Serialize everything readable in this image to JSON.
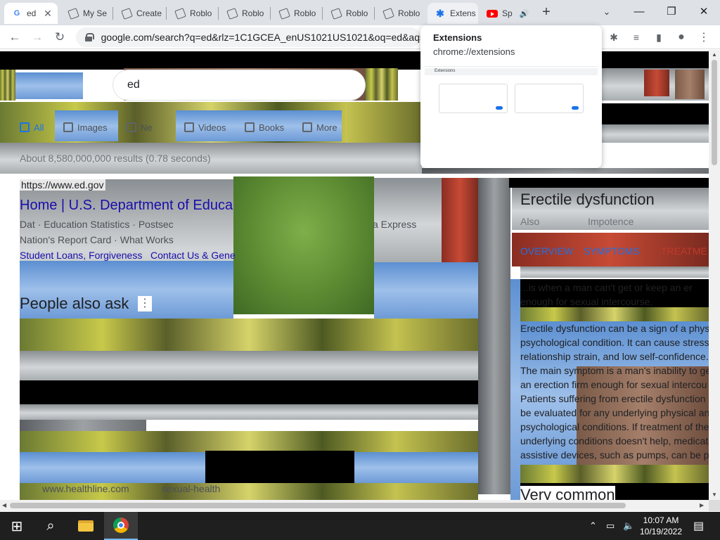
{
  "tabs": [
    {
      "title": "ed",
      "favicon": "google-icon",
      "active": true,
      "closable": true
    },
    {
      "title": "My Se",
      "favicon": "document-icon"
    },
    {
      "title": "Create",
      "favicon": "document-icon"
    },
    {
      "title": "Roblo",
      "favicon": "document-icon"
    },
    {
      "title": "Roblo",
      "favicon": "document-icon"
    },
    {
      "title": "Roblo",
      "favicon": "document-icon"
    },
    {
      "title": "Roblo",
      "favicon": "document-icon"
    },
    {
      "title": "Roblo",
      "favicon": "document-icon"
    },
    {
      "title": "Extens",
      "favicon": "puzzle-icon",
      "hovered": true
    },
    {
      "title": "Sp",
      "favicon": "youtube-icon",
      "audio": true
    }
  ],
  "glyphs": {
    "close": "✕",
    "new_tab": "+",
    "tab_search": "⌄",
    "minimize": "—",
    "restore": "❐",
    "window_close": "✕",
    "back": "←",
    "forward": "→",
    "reload": "↻",
    "puzzle": "✱",
    "queue": "≡",
    "sidepanel": "▮",
    "profile": "●",
    "menu": "⋮",
    "audio": "🔊",
    "up": "▲",
    "down": "▼",
    "left": "◀",
    "right": "▶",
    "kebab": "⋮",
    "windows": "⊞",
    "search": "⌕",
    "chevron_up": "⌃",
    "network": "▭",
    "volume": "🔈",
    "notification": "▤"
  },
  "address_bar": {
    "url": "google.com/search?q=ed&rlz=1C1GCEA_enUS1021US1021&oq=ed&aqs="
  },
  "search": {
    "query": "ed",
    "chips": [
      "All",
      "Images",
      "Ne",
      "Videos",
      "Books",
      "More"
    ],
    "result_stats": "About 8,580,000,000 results (0.78 seconds)",
    "result1": {
      "url": "https://www.ed.gov",
      "title": "Home | U.S. Department of Educa",
      "sitelinks_row1": "Dat    ·    Education Statistics · Postsec",
      "sitelinks_tail": "a Express",
      "sitelinks_row2": "Nation's Report Card · What Works",
      "sitelink_student": "Student Loans, Forgiveness",
      "sitelink_contact": "Contact Us & Gene"
    },
    "people_also_ask": "People also ask",
    "healthline_url": "www.healthline.com",
    "healthline_tail": "sexual-health"
  },
  "knowledge_panel": {
    "title": "Erectile dysfunction",
    "subtitle_left": "Also",
    "subtitle_right": "Impotence",
    "tabs": [
      "OVERVIEW",
      "SYMPTOMS",
      "TREATME"
    ],
    "intro": "...is when a man can't get or keep an er",
    "intro2": "enough for sexual intercourse.",
    "body": [
      "Erectile dysfunction can be a sign of a phys",
      "psychological condition. It can cause stress",
      "relationship strain, and low self-confidence.",
      "The main symptom is a man's inability to ge",
      "an erection firm enough for sexual intercou",
      "Patients suffering from erectile dysfunction",
      "be evaluated for any underlying physical an",
      "psychological conditions. If treatment of the",
      "underlying conditions doesn't help, medicat",
      "assistive devices, such as pumps, can be p"
    ],
    "footer": "Very common"
  },
  "hover_card": {
    "title": "Extensions",
    "url": "chrome://extensions",
    "thumb_header": "Extensions"
  },
  "taskbar": {
    "time": "10:07 AM",
    "date": "10/19/2022"
  },
  "colors": {
    "link": "#1a0dab",
    "tab_strip": "#dee1e6",
    "taskbar": "#1f1f1f",
    "youtube_red": "#ff0000",
    "chrome_blue": "#1a73e8"
  }
}
